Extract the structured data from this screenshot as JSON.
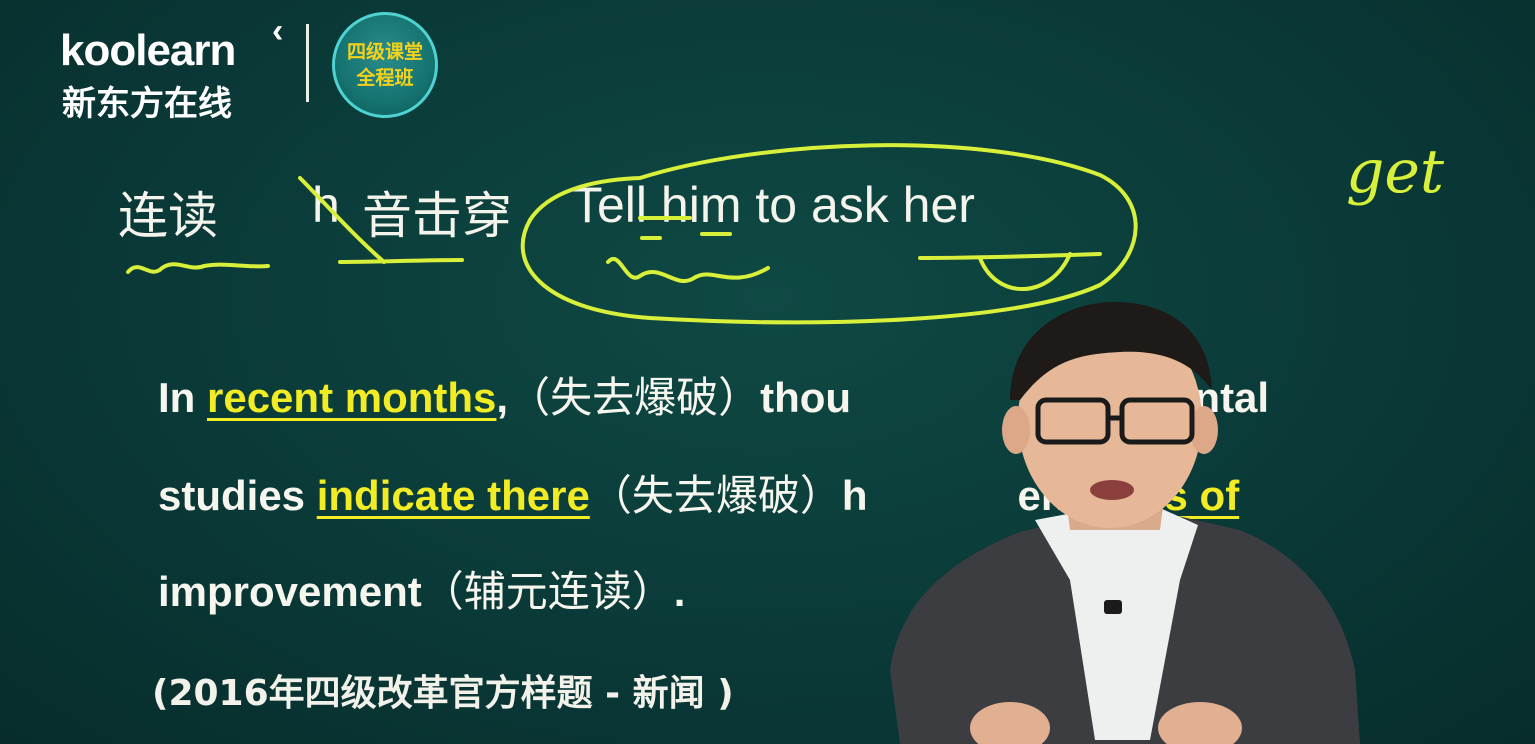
{
  "logo": {
    "brand_en": "koolearn",
    "brand_cn": "新东方在线",
    "badge_line1": "四级课堂",
    "badge_line2": "全程班"
  },
  "heading": {
    "liandu": "连读",
    "h": "h",
    "yin_jichuan": "音击穿",
    "phrase": "Tell him to ask her"
  },
  "handwritten_note": "get",
  "paragraph": {
    "l1_a": "In ",
    "l1_hl": "recent months",
    "l1_b": ",",
    "l1_note": "（失去爆破）",
    "l1_c": "thou",
    "l1_d": "vironmental",
    "l2_a": "studies ",
    "l2_hl": "indicate there",
    "l2_note": "（失去爆破）",
    "l2_b": "h",
    "l2_c": "en ",
    "l2_hl2": "signs of",
    "l3_a": "improvement",
    "l3_note": "（辅元连读）",
    "l3_b": "."
  },
  "source": "(2016年四级改革官方样题 - 新闻 )",
  "colors": {
    "board": "#0a3a38",
    "highlight": "#f1ec24",
    "ink": "#d8f03a"
  }
}
